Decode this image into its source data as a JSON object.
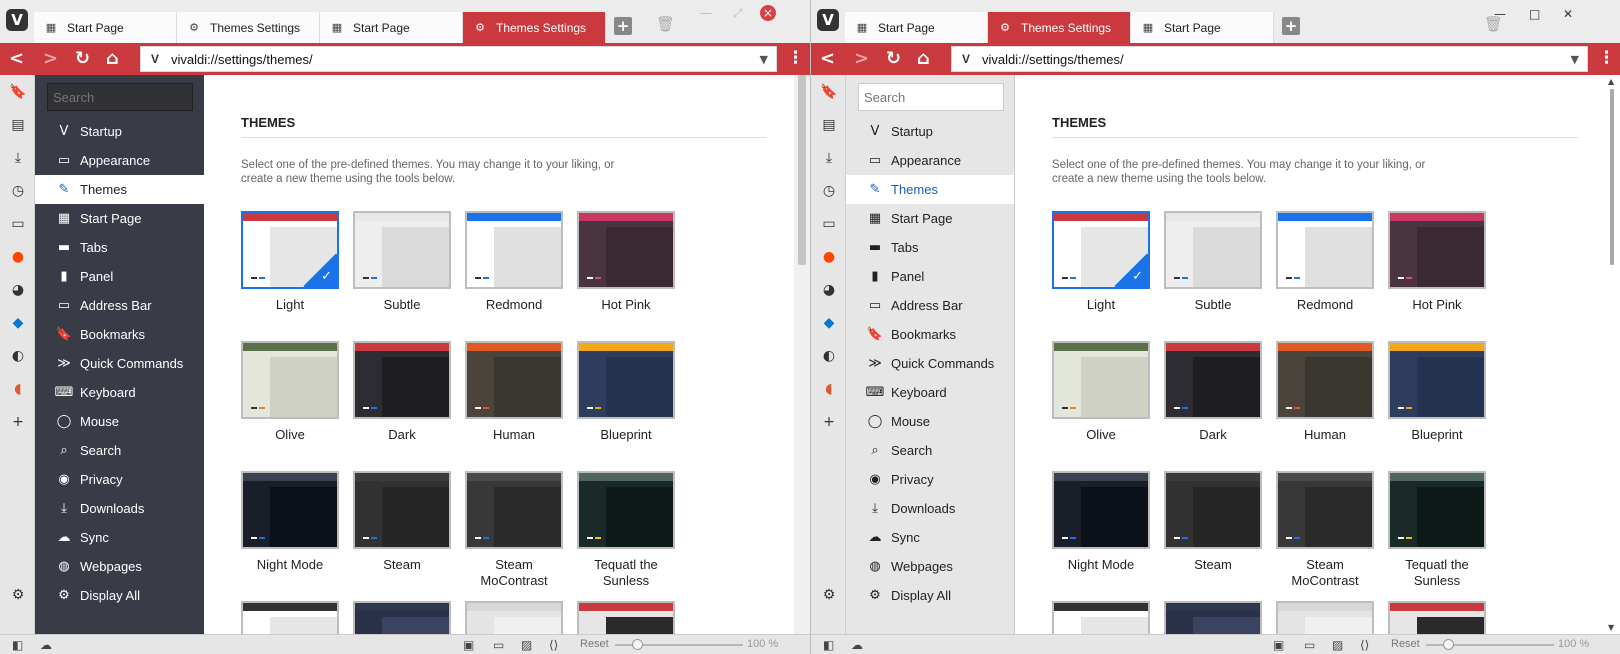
{
  "windows": [
    {
      "key": "left",
      "tabs": [
        {
          "label": "Start Page",
          "icon": "grid-icon",
          "active": false
        },
        {
          "label": "Themes Settings",
          "icon": "gear-icon",
          "active": false
        },
        {
          "label": "Start Page",
          "icon": "grid-icon",
          "active": false
        },
        {
          "label": "Themes Settings",
          "icon": "gear-icon",
          "active": true
        }
      ],
      "url": "vivaldi://settings/themes/",
      "search_placeholder": "Search",
      "zoom": "100 %",
      "reset_label": "Reset"
    },
    {
      "key": "right",
      "tabs": [
        {
          "label": "Start Page",
          "icon": "grid-icon",
          "active": false
        },
        {
          "label": "Themes Settings",
          "icon": "gear-icon",
          "active": true
        },
        {
          "label": "Start Page",
          "icon": "grid-icon",
          "active": false
        }
      ],
      "url": "vivaldi://settings/themes/",
      "search_placeholder": "Search",
      "zoom": "100 %",
      "reset_label": "Reset"
    }
  ],
  "nav_items": [
    {
      "label": "Startup",
      "icon": "vivaldi-icon"
    },
    {
      "label": "Appearance",
      "icon": "window-icon"
    },
    {
      "label": "Themes",
      "icon": "brush-icon",
      "active": true
    },
    {
      "label": "Start Page",
      "icon": "grid-icon"
    },
    {
      "label": "Tabs",
      "icon": "tabs-icon"
    },
    {
      "label": "Panel",
      "icon": "panel-icon"
    },
    {
      "label": "Address Bar",
      "icon": "address-bar-icon"
    },
    {
      "label": "Bookmarks",
      "icon": "bookmark-icon"
    },
    {
      "label": "Quick Commands",
      "icon": "quick-commands-icon"
    },
    {
      "label": "Keyboard",
      "icon": "keyboard-icon"
    },
    {
      "label": "Mouse",
      "icon": "mouse-icon"
    },
    {
      "label": "Search",
      "icon": "search-icon"
    },
    {
      "label": "Privacy",
      "icon": "eye-icon"
    },
    {
      "label": "Downloads",
      "icon": "download-icon"
    },
    {
      "label": "Sync",
      "icon": "cloud-icon"
    },
    {
      "label": "Webpages",
      "icon": "globe-icon"
    },
    {
      "label": "Display All",
      "icon": "gear-icon"
    }
  ],
  "panel_icons": [
    "bookmark-icon",
    "notes-icon",
    "download-icon",
    "history-icon",
    "window-icon",
    "reddit-icon",
    "steam-icon",
    "outlook-icon",
    "penguin-icon",
    "duckduckgo-icon",
    "add-panel-icon"
  ],
  "page": {
    "heading": "THEMES",
    "description": "Select one of the pre-defined themes. You may change it to your liking, or create a new theme using the tools below."
  },
  "themes": [
    {
      "name": "Light",
      "selected": true,
      "accent": "#c9393e",
      "bg": "#e6e6e6",
      "side": "#ffffff",
      "d1": "#333333",
      "d2": "#1a73e8"
    },
    {
      "name": "Subtle",
      "accent": "#e8e8e8",
      "bg": "#dadada",
      "side": "#eeeeee",
      "d1": "#333333",
      "d2": "#1a73e8"
    },
    {
      "name": "Redmond",
      "accent": "#1a73e8",
      "bg": "#e0e0e0",
      "side": "#ffffff",
      "d1": "#333333",
      "d2": "#1a73e8"
    },
    {
      "name": "Hot Pink",
      "accent": "#c9385e",
      "bg": "#3a2832",
      "side": "#4a3440",
      "d1": "#ffffff",
      "d2": "#d85076"
    },
    {
      "name": "Olive",
      "accent": "#5a7048",
      "bg": "#cfd1c4",
      "side": "#e3e6da",
      "d1": "#333333",
      "d2": "#e08a20"
    },
    {
      "name": "Dark",
      "accent": "#c9393e",
      "bg": "#1e1e22",
      "side": "#2c2c32",
      "d1": "#ffffff",
      "d2": "#1a73e8"
    },
    {
      "name": "Human",
      "accent": "#e05a26",
      "bg": "#3a3630",
      "side": "#4a443c",
      "d1": "#ffffff",
      "d2": "#e05a26"
    },
    {
      "name": "Blueprint",
      "accent": "#f0a818",
      "bg": "#253250",
      "side": "#2e3c5e",
      "d1": "#ffffff",
      "d2": "#f0a818"
    },
    {
      "name": "Night Mode",
      "accent": "#3a4250",
      "bg": "#0c1018",
      "side": "#1a1e28",
      "d1": "#ffffff",
      "d2": "#1a73e8"
    },
    {
      "name": "Steam",
      "accent": "#3c3c3c",
      "bg": "#262626",
      "side": "#323232",
      "d1": "#ffffff",
      "d2": "#1a73e8"
    },
    {
      "name": "Steam MoContrast",
      "accent": "#4a4a4a",
      "bg": "#2a2a2a",
      "side": "#383838",
      "d1": "#ffffff",
      "d2": "#1a73e8"
    },
    {
      "name": "Tequatl the Sunless",
      "accent": "#506460",
      "bg": "#0e1a18",
      "side": "#1a2a28",
      "d1": "#ffffff",
      "d2": "#f0c020"
    },
    {
      "name": "",
      "accent": "#333333",
      "bg": "#e6e6e6",
      "side": "#ffffff",
      "d1": "#333333",
      "d2": "#1a73e8"
    },
    {
      "name": "",
      "accent": "#2e3650",
      "bg": "#3a4460",
      "side": "#2a3048",
      "d1": "#ffffff",
      "d2": "#1a73e8"
    },
    {
      "name": "",
      "accent": "#d8d8d8",
      "bg": "#f0f0f0",
      "side": "#e4e4e4",
      "d1": "#333333",
      "d2": "#1a73e8"
    },
    {
      "name": "",
      "accent": "#c9393e",
      "bg": "#2a2a2a",
      "side": "#e6e6e6",
      "d1": "#333333",
      "d2": "#1a73e8"
    }
  ],
  "colors": {
    "accent": "#c9393e",
    "selection": "#1a73e8",
    "dark_panel": "#393c46",
    "light_panel": "#e6e6e6"
  }
}
